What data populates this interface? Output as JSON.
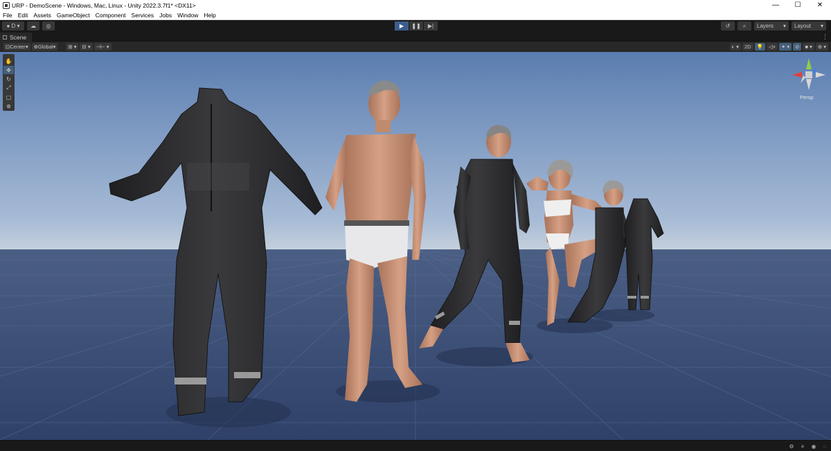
{
  "window": {
    "title": "URP - DemoScene - Windows, Mac, Linux - Unity 2022.3.7f1* <DX11>",
    "controls": {
      "minimize": "—",
      "maximize": "☐",
      "close": "✕"
    }
  },
  "menu": [
    "File",
    "Edit",
    "Assets",
    "GameObject",
    "Component",
    "Services",
    "Jobs",
    "Window",
    "Help"
  ],
  "toolbar": {
    "account_label": "D",
    "layers_label": "Layers",
    "layout_label": "Layout"
  },
  "scene_tab": {
    "label": "Scene"
  },
  "scene_toolbar": {
    "pivot_label": "Center",
    "space_label": "Global",
    "mode_2d_label": "2D"
  },
  "gizmo": {
    "projection_label": "Persp",
    "colors": {
      "x": "#e23f3f",
      "y": "#8cd04a",
      "z": "#3f7fe3"
    }
  },
  "colors": {
    "sky_top": "#5a7db0",
    "sky_horizon": "#b5c6da",
    "ground": "#3a4d74",
    "suit": "#2b2b2d",
    "skin": "#c99173",
    "accent": "#3c5d8c"
  }
}
